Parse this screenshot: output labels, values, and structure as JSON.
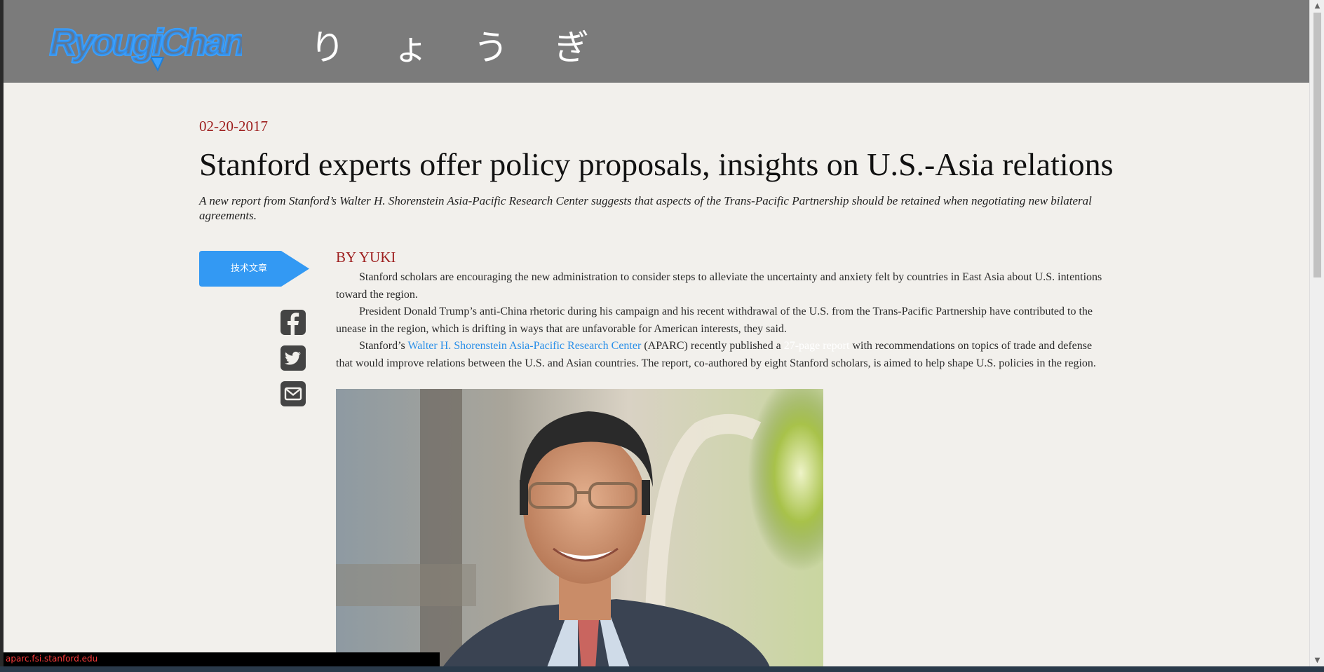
{
  "header": {
    "logo_text": "RyougiChan",
    "kana": [
      "り",
      "ょ",
      "う",
      "ぎ"
    ]
  },
  "article": {
    "date": "02-20-2017",
    "title": "Stanford experts offer policy proposals, insights on U.S.-Asia relations",
    "subtitle": "A new report from Stanford’s Walter H. Shorenstein Asia-Pacific Research Center suggests that aspects of the Trans-Pacific Partnership should be retained when negotiating new bilateral agreements.",
    "category_label": "技术文章",
    "byline": "BY YUKI",
    "p1": "Stanford scholars are encouraging the new administration to consider steps to alleviate the uncertainty and anxiety felt by countries in East Asia about U.S. intentions toward the region.",
    "p2": "President Donald Trump’s anti-China rhetoric during his campaign and his recent withdrawal of the U.S. from the Trans-Pacific Partnership have contributed to the unease in the region, which is drifting in ways that are unfavorable for American interests, they said.",
    "p3_before": "Stanford’s ",
    "p3_link1": "Walter H. Shorenstein Asia-Pacific Research Center",
    "p3_middle": " (APARC) recently published a ",
    "p3_link2": "27-page report",
    "p3_after": " with recommendations on topics of trade and defense that would improve relations between the U.S. and Asian countries. The report, co-authored by eight Stanford scholars, is aimed to help shape U.S. policies in the region."
  },
  "social": {
    "icons": [
      "facebook-icon",
      "twitter-icon",
      "email-icon"
    ]
  },
  "status_bar": {
    "url": "aparc.fsi.stanford.edu"
  },
  "colors": {
    "header_bg": "#7b7b7b",
    "accent_blue": "#2a8fe8",
    "date_red": "#9e1f1f",
    "page_bg": "#f2f0ec"
  }
}
